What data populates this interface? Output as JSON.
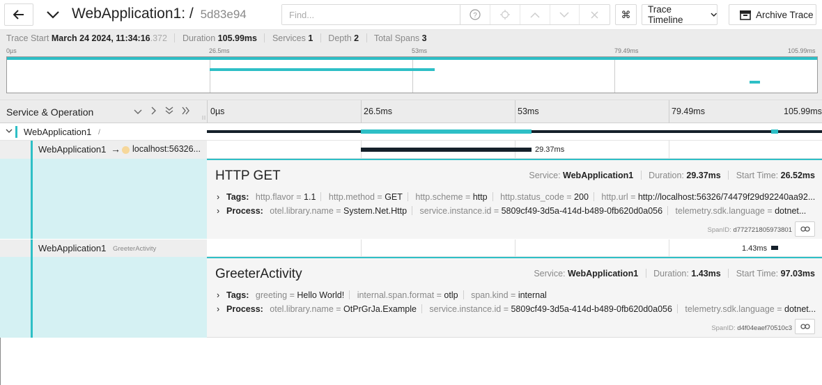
{
  "header": {
    "app_title": "WebApplication1: /",
    "trace_id": "5d83e94",
    "find_placeholder": "Find...",
    "view_mode": "Trace Timeline",
    "archive_label": "Archive Trace",
    "kbd_symbol": "⌘"
  },
  "summary": {
    "trace_start_label": "Trace Start",
    "trace_start_value": "March 24 2024, 11:34:16",
    "trace_start_ms": ".372",
    "duration_label": "Duration",
    "duration_value": "105.99ms",
    "services_label": "Services",
    "services_value": "1",
    "depth_label": "Depth",
    "depth_value": "2",
    "total_spans_label": "Total Spans",
    "total_spans_value": "3"
  },
  "minimap": {
    "ticks": [
      "0µs",
      "26.5ms",
      "53ms",
      "79.49ms",
      "105.99ms"
    ]
  },
  "timeline": {
    "column_title": "Service & Operation",
    "ticks": [
      "0µs",
      "26.5ms",
      "53ms",
      "79.49ms",
      "105.99ms"
    ]
  },
  "spans": [
    {
      "service": "WebApplication1",
      "operation": "/"
    },
    {
      "service": "WebApplication1",
      "arrow": "→",
      "peer": "localhost:56326...",
      "duration_label": "29.37ms",
      "detail": {
        "title": "HTTP GET",
        "service_label": "Service:",
        "service_value": "WebApplication1",
        "duration_label": "Duration:",
        "duration_value": "29.37ms",
        "start_label": "Start Time:",
        "start_value": "26.52ms",
        "tags_label": "Tags:",
        "tags": [
          {
            "k": "http.flavor",
            "v": "1.1"
          },
          {
            "k": "http.method",
            "v": "GET"
          },
          {
            "k": "http.scheme",
            "v": "http"
          },
          {
            "k": "http.status_code",
            "v": "200"
          },
          {
            "k": "http.url",
            "v": "http://localhost:56326/74479f29d92240aa92..."
          }
        ],
        "process_label": "Process:",
        "process": [
          {
            "k": "otel.library.name",
            "v": "System.Net.Http"
          },
          {
            "k": "service.instance.id",
            "v": "5809cf49-3d5a-414d-b489-0fb620d0a056"
          },
          {
            "k": "telemetry.sdk.language",
            "v": "dotnet..."
          }
        ],
        "spanid_label": "SpanID:",
        "spanid_value": "d772721805973801"
      }
    },
    {
      "service": "WebApplication1",
      "operation": "GreeterActivity",
      "duration_label": "1.43ms",
      "detail": {
        "title": "GreeterActivity",
        "service_label": "Service:",
        "service_value": "WebApplication1",
        "duration_label": "Duration:",
        "duration_value": "1.43ms",
        "start_label": "Start Time:",
        "start_value": "97.03ms",
        "tags_label": "Tags:",
        "tags": [
          {
            "k": "greeting",
            "v": "Hello World!"
          },
          {
            "k": "internal.span.format",
            "v": "otlp"
          },
          {
            "k": "span.kind",
            "v": "internal"
          }
        ],
        "process_label": "Process:",
        "process": [
          {
            "k": "otel.library.name",
            "v": "OtPrGrJa.Example"
          },
          {
            "k": "service.instance.id",
            "v": "5809cf49-3d5a-414d-b489-0fb620d0a056"
          },
          {
            "k": "telemetry.sdk.language",
            "v": "dotnet..."
          }
        ],
        "spanid_label": "SpanID:",
        "spanid_value": "d4f04eaef70510c3"
      }
    }
  ],
  "colors": {
    "accent": "#2ebfc6",
    "span_bar": "#15202a",
    "detail_left_bg": "#d5f1f3"
  }
}
